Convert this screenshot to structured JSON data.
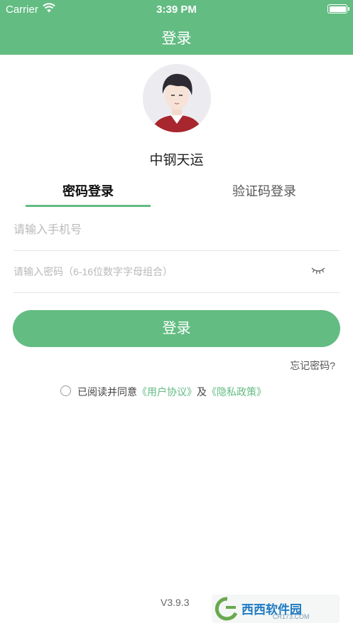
{
  "status_bar": {
    "carrier": "Carrier",
    "time": "3:39 PM"
  },
  "nav": {
    "title": "登录"
  },
  "profile": {
    "app_name": "中钢天运"
  },
  "tabs": [
    {
      "label": "密码登录",
      "active": true
    },
    {
      "label": "验证码登录",
      "active": false
    }
  ],
  "form": {
    "phone": {
      "value": "",
      "placeholder": "请输入手机号"
    },
    "password": {
      "value": "",
      "placeholder": "请输入密码（6-16位数字字母组合）"
    }
  },
  "login_button": {
    "label": "登录"
  },
  "forgot_password": {
    "label": "忘记密码?"
  },
  "agreement": {
    "prefix": "已阅读并同意",
    "user_agreement": "《用户协议》",
    "conjunction": "及",
    "privacy_policy": "《隐私政策》",
    "checked": false
  },
  "footer": {
    "version": "V3.9.3"
  },
  "watermark": {
    "logo_text": "西西软件园",
    "domain": "CR173.COM"
  },
  "colors": {
    "accent": "#63bc82",
    "status_bar_text": "#ffffff",
    "link": "#63bc82"
  },
  "icons": [
    "wifi-icon",
    "battery-icon",
    "eye-closed-icon",
    "radio-unchecked-icon"
  ]
}
